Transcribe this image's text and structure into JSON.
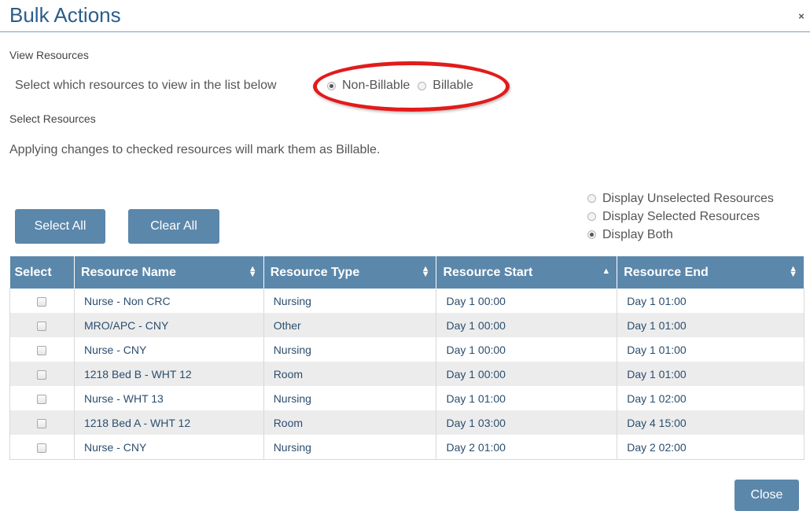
{
  "dialog": {
    "title": "Bulk Actions",
    "close_icon_glyph": "×"
  },
  "view_resources": {
    "label": "View Resources",
    "prompt": "Select which resources to view in the list below",
    "options": [
      {
        "label": "Non-Billable",
        "checked": true
      },
      {
        "label": "Billable",
        "checked": false
      }
    ]
  },
  "select_resources": {
    "label": "Select Resources",
    "note": "Applying changes to checked resources will mark them as Billable."
  },
  "buttons": {
    "select_all": "Select All",
    "clear_all": "Clear All",
    "close": "Close"
  },
  "display_options": [
    {
      "label": "Display Unselected Resources",
      "checked": false
    },
    {
      "label": "Display Selected Resources",
      "checked": false
    },
    {
      "label": "Display Both",
      "checked": true
    }
  ],
  "table": {
    "headers": [
      "Select",
      "Resource Name",
      "Resource Type",
      "Resource Start",
      "Resource End"
    ],
    "rows": [
      {
        "name": "Nurse - Non CRC",
        "type": "Nursing",
        "start": "Day 1 00:00",
        "end": "Day 1 01:00"
      },
      {
        "name": "MRO/APC - CNY",
        "type": "Other",
        "start": "Day 1 00:00",
        "end": "Day 1 01:00"
      },
      {
        "name": "Nurse - CNY",
        "type": "Nursing",
        "start": "Day 1 00:00",
        "end": "Day 1 01:00"
      },
      {
        "name": "1218 Bed B - WHT 12",
        "type": "Room",
        "start": "Day 1 00:00",
        "end": "Day 1 01:00"
      },
      {
        "name": "Nurse - WHT 13",
        "type": "Nursing",
        "start": "Day 1 01:00",
        "end": "Day 1 02:00"
      },
      {
        "name": "1218 Bed A - WHT 12",
        "type": "Room",
        "start": "Day 1 03:00",
        "end": "Day 4 15:00"
      },
      {
        "name": "Nurse - CNY",
        "type": "Nursing",
        "start": "Day 2 01:00",
        "end": "Day 2 02:00"
      }
    ]
  },
  "colors": {
    "accent": "#5b87ab",
    "title": "#2a5d8a",
    "annotation": "#e21b1b"
  }
}
